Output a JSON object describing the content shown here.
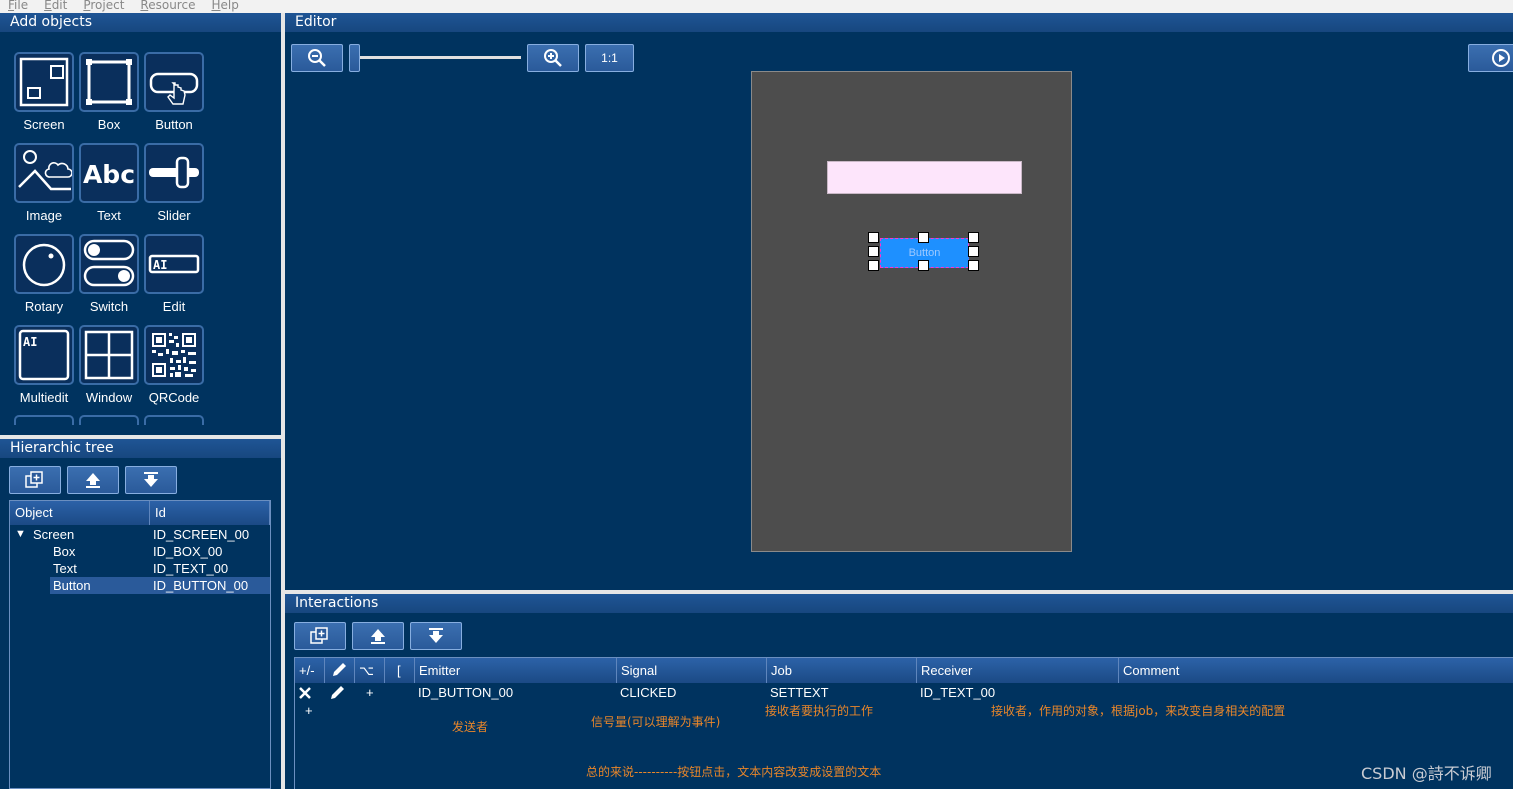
{
  "menu": [
    "File",
    "Edit",
    "Project",
    "Resource",
    "Help"
  ],
  "add_objects": {
    "title": "Add objects",
    "items": [
      {
        "label": "Screen",
        "icon": "screen-icon"
      },
      {
        "label": "Box",
        "icon": "box-icon"
      },
      {
        "label": "Button",
        "icon": "button-icon"
      },
      {
        "label": "Image",
        "icon": "image-icon"
      },
      {
        "label": "Text",
        "icon": "text-icon",
        "glyph": "Abc"
      },
      {
        "label": "Slider",
        "icon": "slider-icon"
      },
      {
        "label": "Rotary",
        "icon": "rotary-icon"
      },
      {
        "label": "Switch",
        "icon": "switch-icon"
      },
      {
        "label": "Edit",
        "icon": "edit-icon",
        "glyph": "AI"
      },
      {
        "label": "Multiedit",
        "icon": "multiedit-icon",
        "glyph": "AI"
      },
      {
        "label": "Window",
        "icon": "window-icon"
      },
      {
        "label": "QRCode",
        "icon": "qrcode-icon"
      }
    ]
  },
  "hierarchy": {
    "title": "Hierarchic tree",
    "columns": [
      "Object",
      "Id"
    ],
    "rows": [
      {
        "object": "Screen",
        "id": "ID_SCREEN_00",
        "expanded": true
      },
      {
        "object": "Box",
        "id": "ID_BOX_00"
      },
      {
        "object": "Text",
        "id": "ID_TEXT_00"
      },
      {
        "object": "Button",
        "id": "ID_BUTTON_00",
        "selected": true
      }
    ]
  },
  "editor": {
    "title": "Editor",
    "zoom_reset_label": "1:1",
    "canvas_button_text": "Button"
  },
  "interactions": {
    "title": "Interactions",
    "columns": [
      "+/-",
      "",
      "⌥",
      "[",
      "Emitter",
      "Signal",
      "Job",
      "Receiver",
      "Comment"
    ],
    "rows": [
      {
        "emitter": "ID_BUTTON_00",
        "signal": "CLICKED",
        "job": "SETTEXT",
        "receiver": "ID_TEXT_00",
        "comment": "",
        "sign": "+"
      }
    ],
    "add_row_label": "+",
    "notes": {
      "emitter": "发送者",
      "signal": "信号量(可以理解为事件)",
      "job": "接收者要执行的工作",
      "receiver": "接收者，作用的对象，根据job，来改变自身相关的配置",
      "summary": "总的来说----------按钮点击，文本内容改变成设置的文本"
    }
  },
  "watermark": "CSDN @詩不诉卿",
  "colors": {
    "panel_bg": "#00335f",
    "title_bar": "#1f5595",
    "canvas_bg": "#4d4d4d",
    "text_box": "#fde5fb",
    "selected_button": "#1e90ff",
    "selection_row": "#2a5a9a",
    "annotation": "#e8862a"
  }
}
